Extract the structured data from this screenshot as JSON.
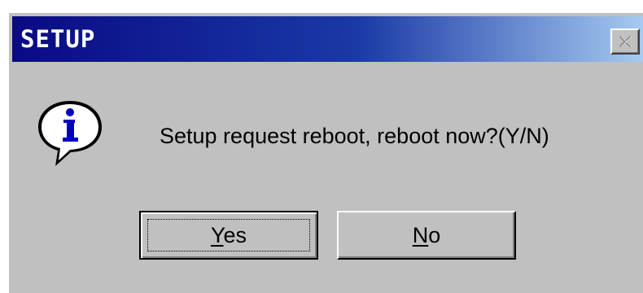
{
  "window": {
    "title": "SETUP",
    "titlebar_gradient_start": "#0a0a84",
    "titlebar_gradient_end": "#a6caf0",
    "background_color": "#c0c0c0"
  },
  "titlebar_buttons": {
    "close_icon": "close-icon"
  },
  "message": {
    "icon": "information-icon",
    "text": "Setup request reboot, reboot now?(Y/N)"
  },
  "buttons": {
    "yes_label": "Yes",
    "no_label": "No",
    "default_button": "Yes"
  }
}
